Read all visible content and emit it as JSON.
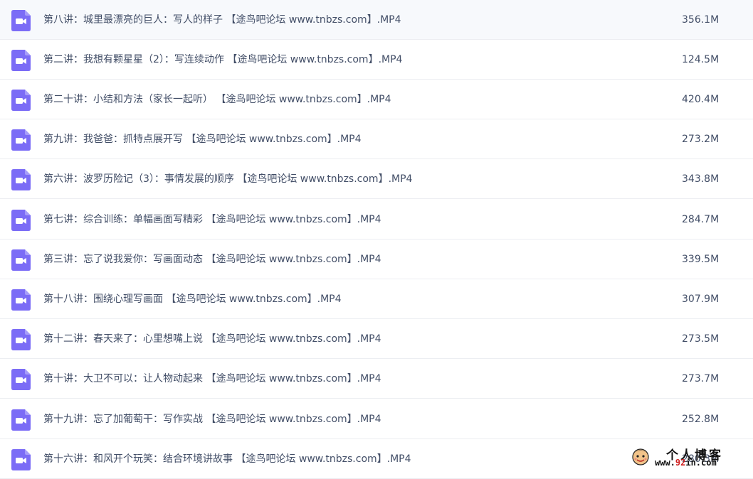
{
  "files": [
    {
      "name": "第八讲：城里最漂亮的巨人：写人的样子 【途鸟吧论坛 www.tnbzs.com】.MP4",
      "size": "356.1M"
    },
    {
      "name": "第二讲：我想有颗星星（2）：写连续动作 【途鸟吧论坛 www.tnbzs.com】.MP4",
      "size": "124.5M"
    },
    {
      "name": "第二十讲：小结和方法（家长一起听） 【途鸟吧论坛 www.tnbzs.com】.MP4",
      "size": "420.4M"
    },
    {
      "name": "第九讲：我爸爸：抓特点展开写 【途鸟吧论坛 www.tnbzs.com】.MP4",
      "size": "273.2M"
    },
    {
      "name": "第六讲：波罗历险记（3）：事情发展的顺序 【途鸟吧论坛 www.tnbzs.com】.MP4",
      "size": "343.8M"
    },
    {
      "name": "第七讲：综合训练：单幅画面写精彩 【途鸟吧论坛 www.tnbzs.com】.MP4",
      "size": "284.7M"
    },
    {
      "name": "第三讲：忘了说我爱你：写画面动态 【途鸟吧论坛 www.tnbzs.com】.MP4",
      "size": "339.5M"
    },
    {
      "name": "第十八讲：围绕心理写画面 【途鸟吧论坛 www.tnbzs.com】.MP4",
      "size": "307.9M"
    },
    {
      "name": "第十二讲：春天来了：心里想嘴上说 【途鸟吧论坛 www.tnbzs.com】.MP4",
      "size": "273.5M"
    },
    {
      "name": "第十讲：大卫不可以：让人物动起来 【途鸟吧论坛 www.tnbzs.com】.MP4",
      "size": "273.7M"
    },
    {
      "name": "第十九讲：忘了加葡萄干：写作实战 【途鸟吧论坛 www.tnbzs.com】.MP4",
      "size": "252.8M"
    },
    {
      "name": "第十六讲：和风开个玩笑：结合环境讲故事 【途鸟吧论坛 www.tnbzs.com】.MP4",
      "size": "280.3M"
    }
  ],
  "icon": {
    "name": "video-file-icon",
    "color": "#7b6cf6"
  },
  "watermark": {
    "title": "个人博客",
    "url_prefix": "www.",
    "url_number": "92",
    "url_suffix": "in.com"
  }
}
